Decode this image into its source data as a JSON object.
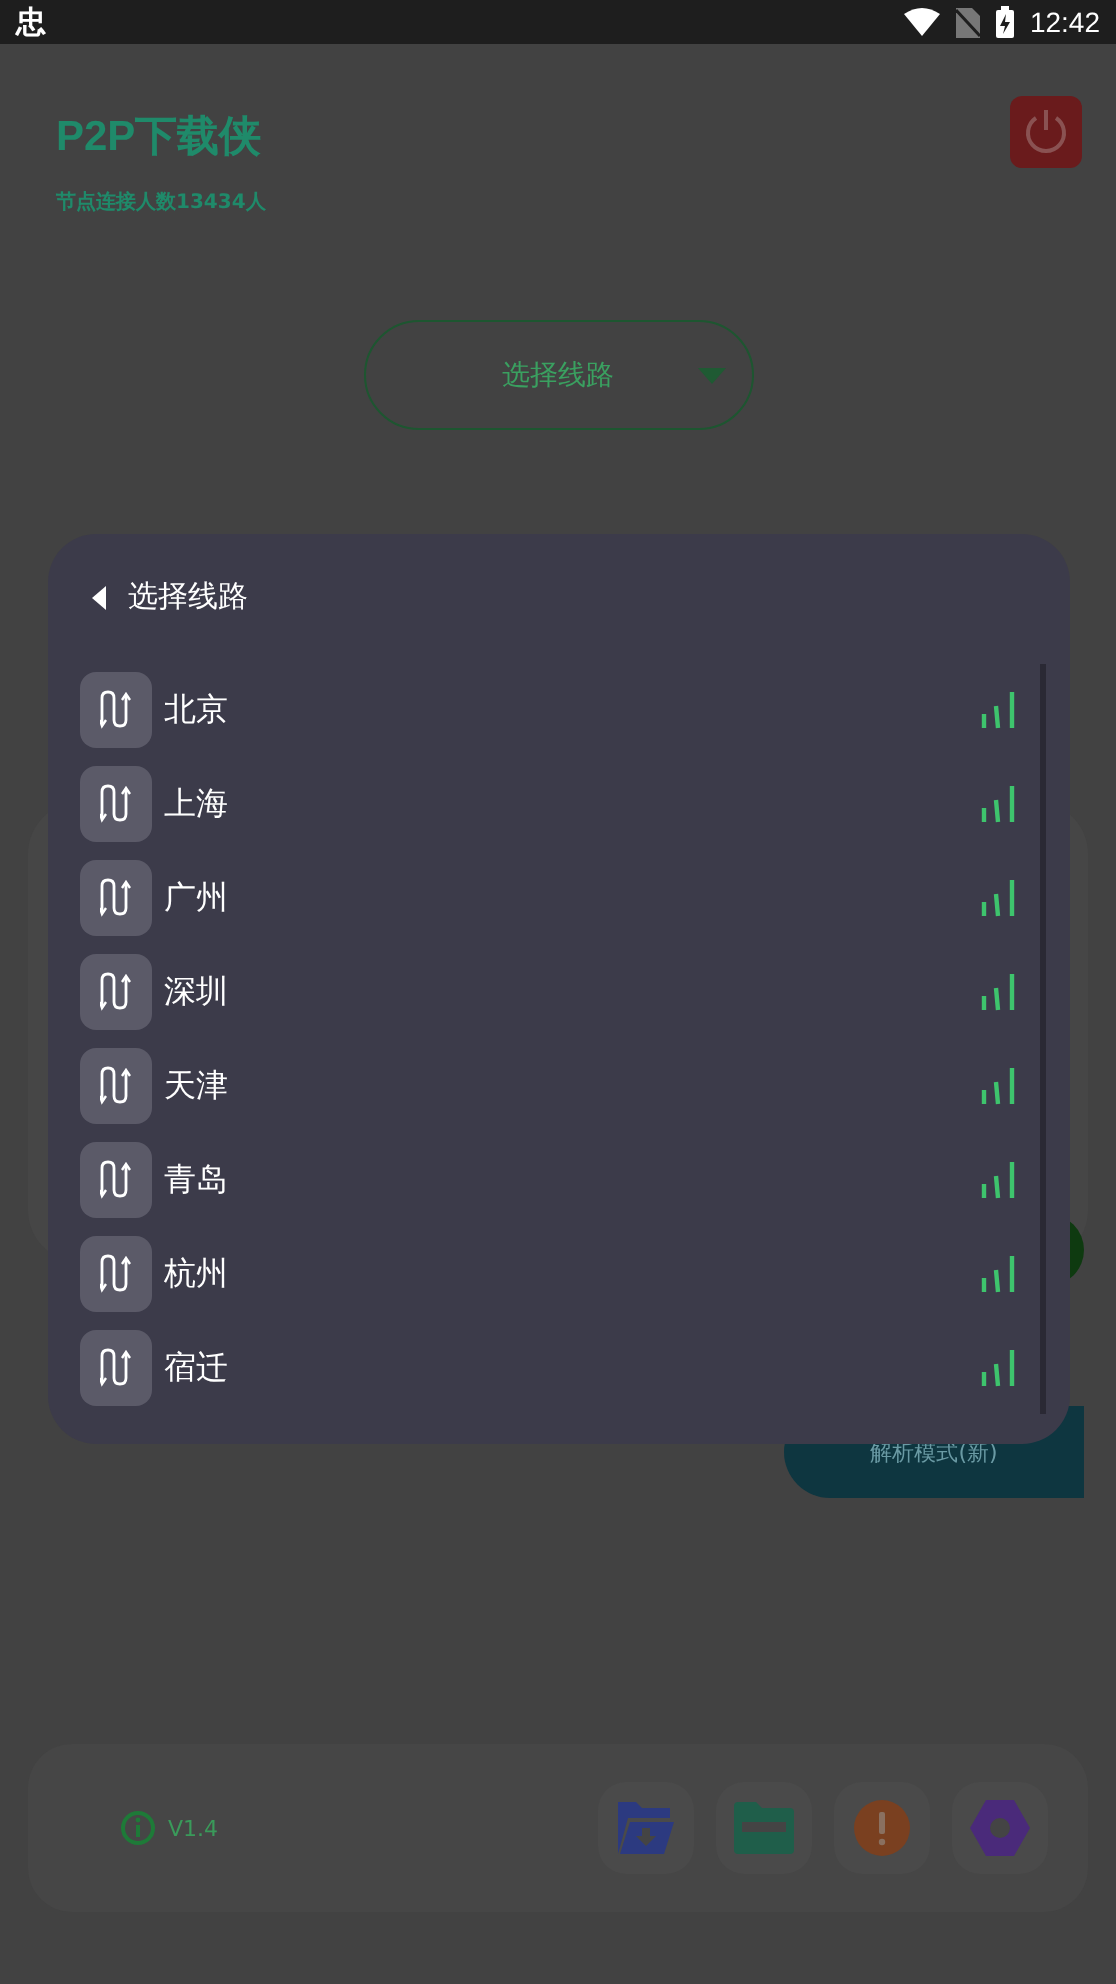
{
  "status_bar": {
    "app_icon": "忠",
    "time": "12:42"
  },
  "header": {
    "title": "P2P下载侠",
    "subtitle": "节点连接人数13434人"
  },
  "route_selector": {
    "label": "选择线路"
  },
  "parse_button": {
    "label": "解析模式(新)"
  },
  "footer": {
    "version": "V1.4"
  },
  "dialog": {
    "title": "选择线路",
    "routes": [
      {
        "name": "北京"
      },
      {
        "name": "上海"
      },
      {
        "name": "广州"
      },
      {
        "name": "深圳"
      },
      {
        "name": "天津"
      },
      {
        "name": "青岛"
      },
      {
        "name": "杭州"
      },
      {
        "name": "宿迁"
      }
    ]
  }
}
